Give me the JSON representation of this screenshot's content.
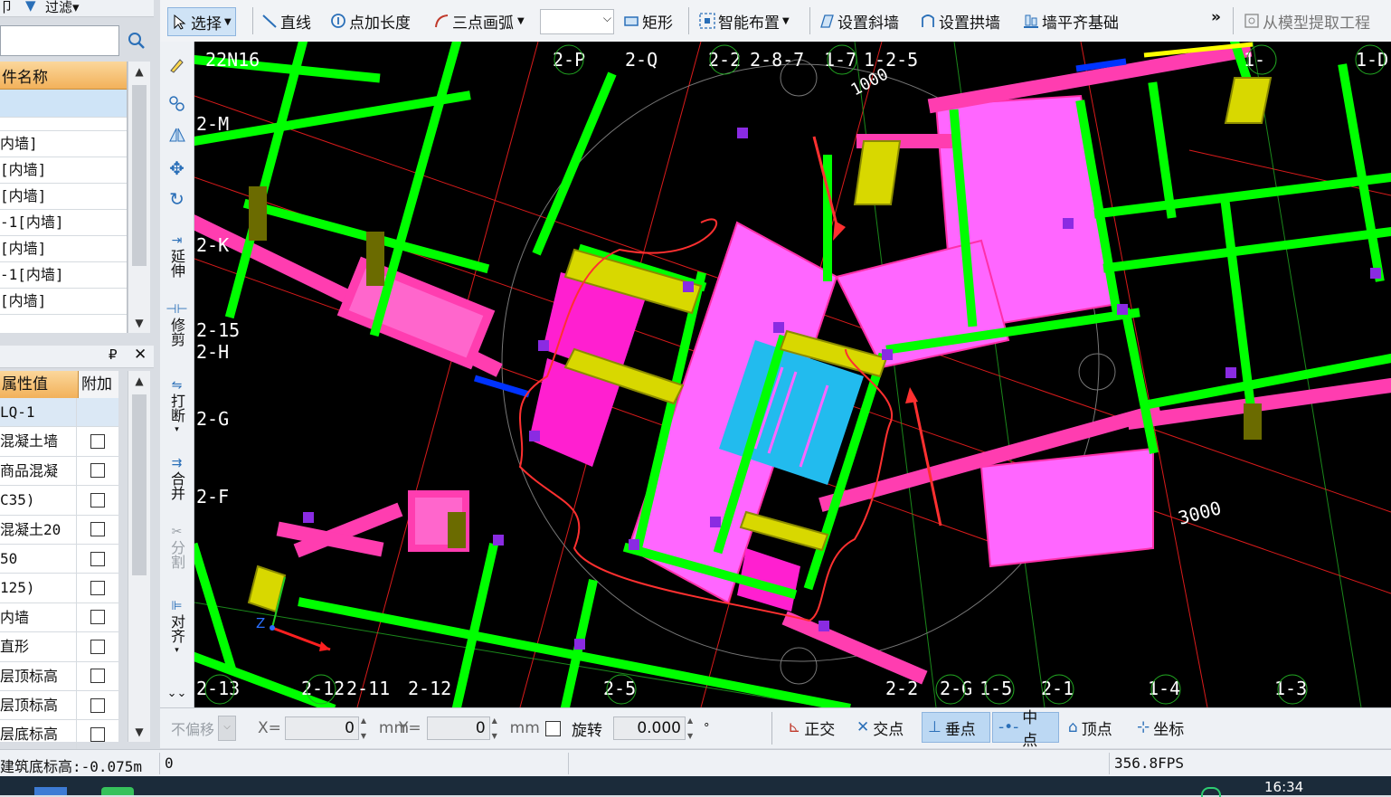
{
  "left_top": {
    "filter_label": "过滤▾"
  },
  "component_list": {
    "header": "件名称",
    "rows": [
      "内墙]",
      "[内墙]",
      "[内墙]",
      "-1[内墙]",
      "[内墙]",
      "-1[内墙]",
      "[内墙]"
    ]
  },
  "properties": {
    "col_value": "属性值",
    "col_extra": "附加",
    "rows": [
      "LQ-1",
      "混凝土墙",
      "商品混凝",
      "C35)",
      "混凝土20",
      "50",
      "125)",
      "内墙",
      "直形",
      "层顶标高",
      "层顶标高",
      "层底标高"
    ]
  },
  "toolbar": {
    "select": "选择",
    "line": "直线",
    "add_length": "点加长度",
    "arc": "三点画弧",
    "rect": "矩形",
    "smart_layout": "智能布置",
    "slope_wall": "设置斜墙",
    "arch_wall": "设置拱墙",
    "wall_align_foundation": "墙平齐基础",
    "more": "»",
    "extract": "从模型提取工程"
  },
  "vtoolbar": {
    "extend": "延伸",
    "trim": "修剪",
    "break": "打断",
    "merge": "合并",
    "split": "分割",
    "align": "对齐"
  },
  "canvas": {
    "axis_labels": [
      "22N16",
      "2-P",
      "2-Q",
      "2-2",
      "2-8-7",
      "1-7",
      "1-2-5",
      "1-",
      "1-D",
      "2-M",
      "2-K",
      "2-15",
      "2-H",
      "2-G",
      "2-F",
      "2-13",
      "2-12",
      "2-11",
      "2-12",
      "2-5",
      "2-2",
      "2-G",
      "1-5",
      "2-1",
      "1-4",
      "1-3"
    ],
    "dimension_1": "1000",
    "dimension_2": "3000",
    "ucs_z": "Z"
  },
  "coord_bar": {
    "offset_mode": "不偏移",
    "x_label": "X=",
    "x_value": "0",
    "mm1": "mm",
    "y_label": "Y=",
    "y_value": "0",
    "mm2": "mm",
    "rotate_label": "旋转",
    "rotate_value": "0.000",
    "degree": "°",
    "snap_ortho": "正交",
    "snap_intersect": "交点",
    "snap_perp": "垂点",
    "snap_mid": "中点",
    "snap_vertex": "顶点",
    "snap_coord": "坐标"
  },
  "status_bar": {
    "elevation": "建筑底标高:-0.075m",
    "value": "0",
    "fps": "356.8FPS"
  },
  "taskbar": {
    "clock": "16:34"
  },
  "colors": {
    "wall_green": "#00ff00",
    "wall_pink": "#ff4db8",
    "slab_magenta": "#ff66ff",
    "column_purple": "#8a2be2",
    "annotation_red": "#ff3030"
  }
}
